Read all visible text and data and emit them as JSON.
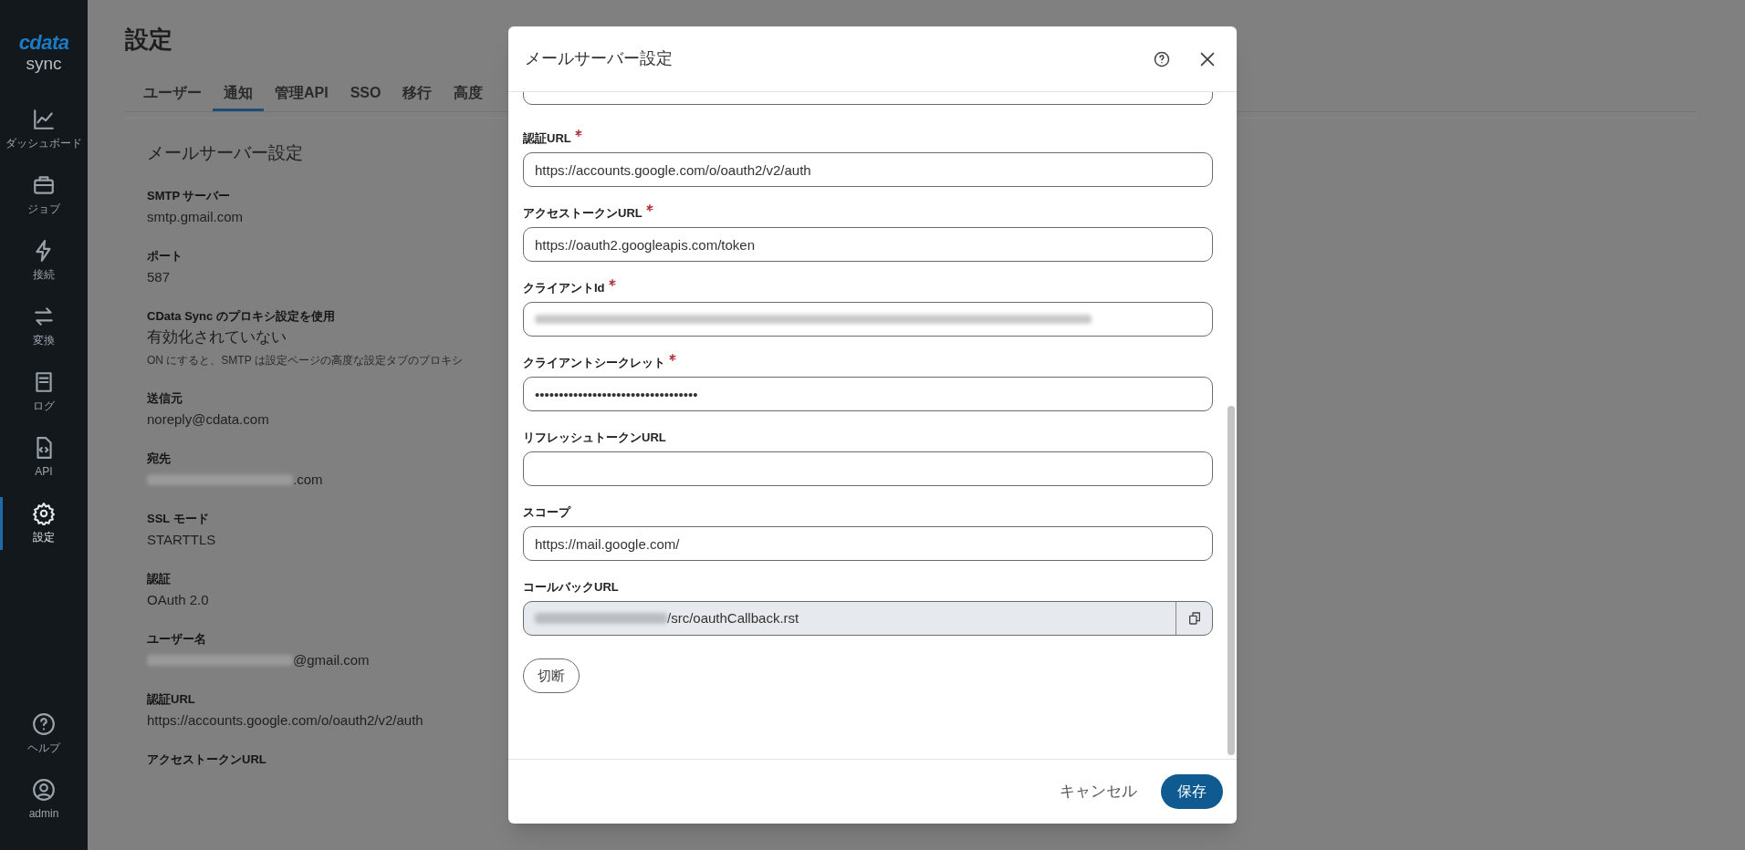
{
  "sidebar": {
    "logo": {
      "brand": "cdata",
      "product": "sync"
    },
    "items": [
      {
        "label": "ダッシュボード",
        "selected": false
      },
      {
        "label": "ジョブ",
        "selected": false
      },
      {
        "label": "接続",
        "selected": false
      },
      {
        "label": "変換",
        "selected": false
      },
      {
        "label": "ログ",
        "selected": false
      },
      {
        "label": "API",
        "selected": false
      },
      {
        "label": "設定",
        "selected": true
      }
    ],
    "bottom_items": [
      {
        "label": "ヘルプ"
      },
      {
        "label": "admin"
      }
    ]
  },
  "page": {
    "title": "設定",
    "tabs": [
      {
        "label": "ユーザー",
        "selected": false
      },
      {
        "label": "通知",
        "selected": true
      },
      {
        "label": "管理API",
        "selected": false
      },
      {
        "label": "SSO",
        "selected": false
      },
      {
        "label": "移行",
        "selected": false
      },
      {
        "label": "高度",
        "selected": false
      }
    ],
    "card": {
      "title": "メールサーバー設定",
      "fields": [
        {
          "label": "SMTP サーバー",
          "value": "smtp.gmail.com"
        },
        {
          "label": "ポート",
          "value": "587"
        },
        {
          "label": "CData Sync のプロキシ設定を使用",
          "value": "有効化されていない",
          "note": "ON にすると、SMTP は設定ページの高度な設定タブのプロキシ"
        },
        {
          "label": "送信元",
          "value": "noreply@cdata.com"
        },
        {
          "label": "宛先",
          "value": ".com",
          "redacted": true
        },
        {
          "label": "SSL モード",
          "value": "STARTTLS"
        },
        {
          "label": "認証",
          "value": "OAuth 2.0"
        },
        {
          "label": "ユーザー名",
          "value": "@gmail.com",
          "redacted": true
        },
        {
          "label": "認証URL",
          "value": "https://accounts.google.com/o/oauth2/v2/auth"
        },
        {
          "label": "アクセストークンURL"
        }
      ]
    }
  },
  "modal": {
    "title": "メールサーバー設定",
    "fields": [
      {
        "kind": "cut"
      },
      {
        "kind": "text",
        "label": "認証URL",
        "required": true,
        "value": "https://accounts.google.com/o/oauth2/v2/auth"
      },
      {
        "kind": "text",
        "label": "アクセストークンURL",
        "required": true,
        "value": "https://oauth2.googleapis.com/token"
      },
      {
        "kind": "redacted",
        "label": "クライアントId",
        "required": true
      },
      {
        "kind": "text",
        "label": "クライアントシークレット",
        "required": true,
        "value": "••••••••••••••••••••••••••••••••••"
      },
      {
        "kind": "text",
        "label": "リフレッシュトークンURL"
      },
      {
        "kind": "text",
        "label": "スコープ",
        "value": "https://mail.google.com/"
      },
      {
        "kind": "copy",
        "label": "コールバックURL",
        "value": "/src/oauthCallback.rst"
      }
    ],
    "disconnect": "切断",
    "cancel": "キャンセル",
    "save": "保存"
  }
}
